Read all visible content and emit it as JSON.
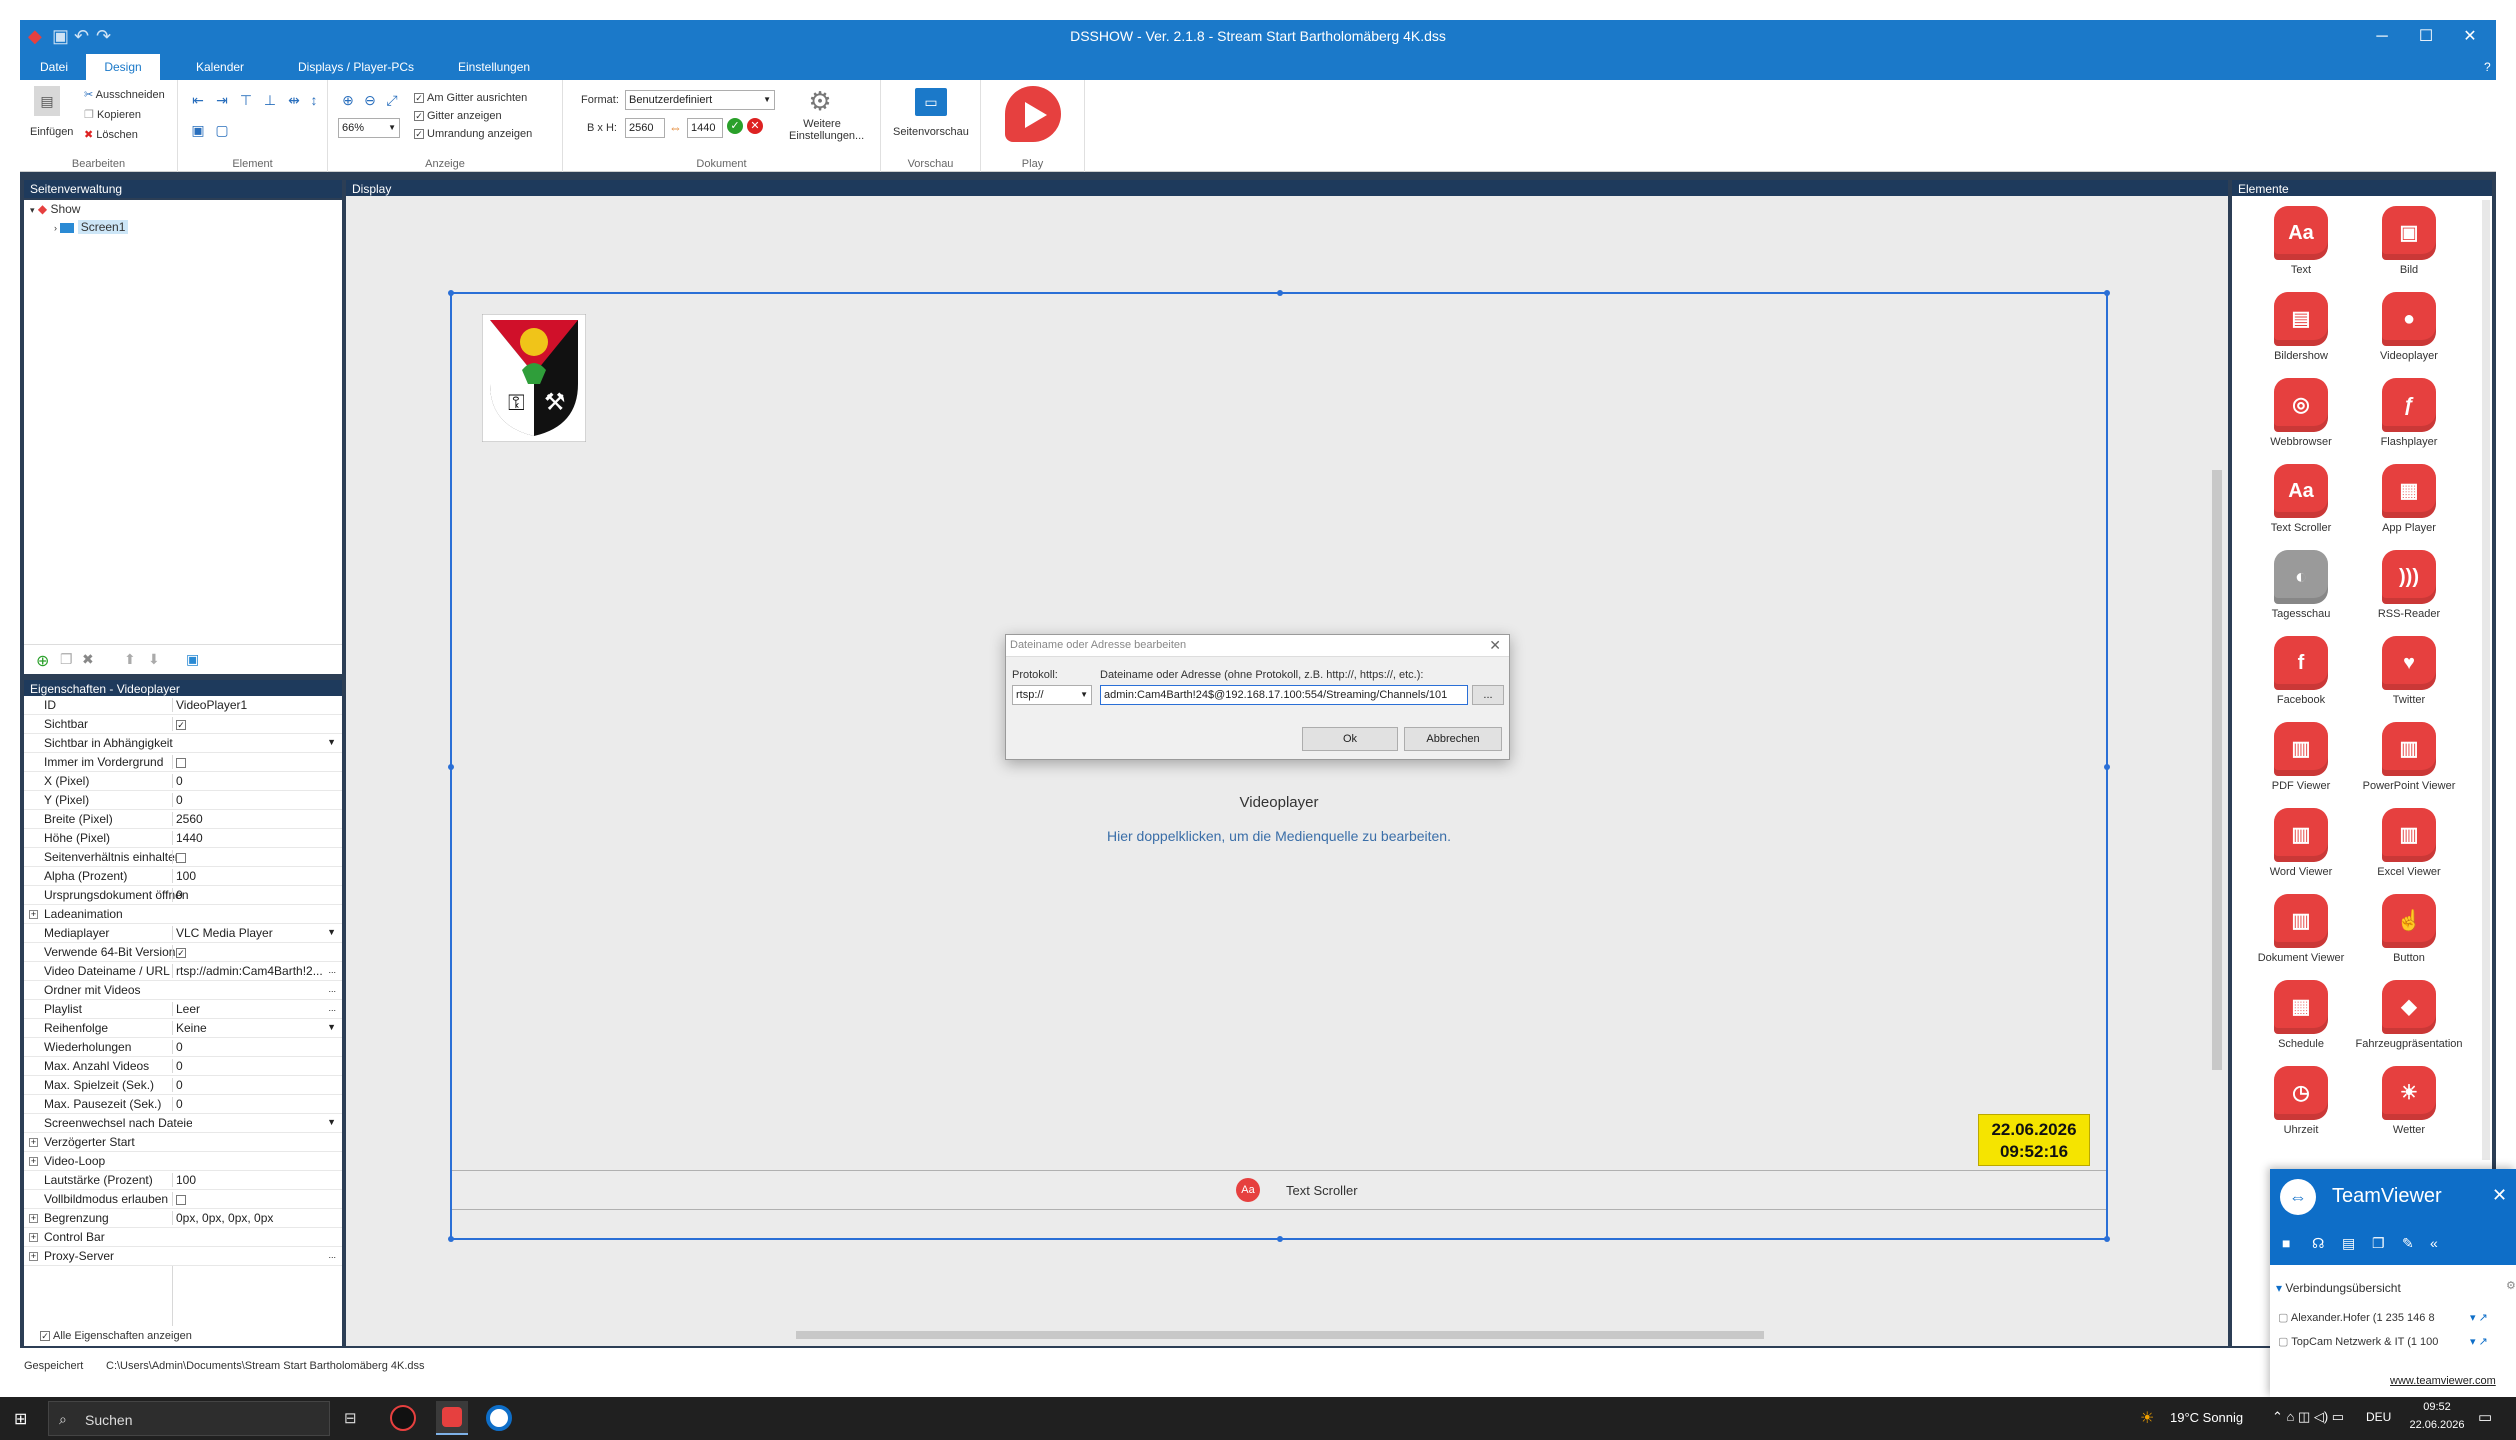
{
  "app": {
    "title": "DSSHOW - Ver. 2.1.8 - Stream Start Bartholomäberg 4K.dss",
    "menu_tabs": [
      "Datei",
      "Design",
      "Kalender",
      "Displays / Player-PCs",
      "Einstellungen"
    ],
    "active_tab": "Design"
  },
  "ribbon": {
    "bearbeiten": {
      "label": "Bearbeiten",
      "paste": "Einfügen",
      "cut": "Ausschneiden",
      "copy": "Kopieren",
      "delete": "Löschen"
    },
    "element": {
      "label": "Element"
    },
    "anzeige": {
      "label": "Anzeige",
      "zoom": "66%",
      "grid_snap": "Am Gitter ausrichten",
      "grid_show": "Gitter anzeigen",
      "border_show": "Umrandung anzeigen"
    },
    "dokument": {
      "label": "Dokument",
      "format_label": "Format:",
      "format_value": "Benutzerdefiniert",
      "size_label": "B x H:",
      "width": "2560",
      "height": "1440",
      "more_settings": "Weitere Einstellungen..."
    },
    "vorschau": {
      "label": "Vorschau",
      "page_preview": "Seitenvorschau"
    },
    "play": {
      "label": "Play"
    }
  },
  "left": {
    "pages_title": "Seitenverwaltung",
    "tree": {
      "root": "Show",
      "child": "Screen1"
    },
    "props_title": "Eigenschaften - Videoplayer",
    "props": [
      {
        "name": "ID",
        "value": "VideoPlayer1"
      },
      {
        "name": "Sichtbar",
        "value": "",
        "check": "true"
      },
      {
        "name": "Sichtbar in Abhängigkeit",
        "value": "",
        "dd": "true"
      },
      {
        "name": "Immer im Vordergrund",
        "value": "",
        "check": "false"
      },
      {
        "name": "X (Pixel)",
        "value": "0"
      },
      {
        "name": "Y (Pixel)",
        "value": "0"
      },
      {
        "name": "Breite (Pixel)",
        "value": "2560"
      },
      {
        "name": "Höhe (Pixel)",
        "value": "1440"
      },
      {
        "name": "Seitenverhältnis einhalten",
        "value": "",
        "check": "false"
      },
      {
        "name": "Alpha (Prozent)",
        "value": "100"
      },
      {
        "name": "Ursprungsdokument öffnen",
        "value": "0"
      },
      {
        "name": "Ladeanimation",
        "value": "",
        "exp": "true"
      },
      {
        "name": "Mediaplayer",
        "value": "VLC Media Player",
        "dd": "true"
      },
      {
        "name": "Verwende 64-Bit Version",
        "value": "",
        "check": "true"
      },
      {
        "name": "Video Dateiname / URL",
        "value": "rtsp://admin:Cam4Barth!2...",
        "more": "true"
      },
      {
        "name": "Ordner mit Videos",
        "value": "",
        "more": "true"
      },
      {
        "name": "Playlist",
        "value": "Leer",
        "more": "true"
      },
      {
        "name": "Reihenfolge",
        "value": "Keine",
        "dd": "true"
      },
      {
        "name": "Wiederholungen",
        "value": "0"
      },
      {
        "name": "Max. Anzahl Videos",
        "value": "0"
      },
      {
        "name": "Max. Spielzeit (Sek.)",
        "value": "0"
      },
      {
        "name": "Max. Pausezeit (Sek.)",
        "value": "0"
      },
      {
        "name": "Screenwechsel nach Dateiende",
        "value": "",
        "dd": "true"
      },
      {
        "name": "Verzögerter Start",
        "value": "",
        "exp": "true"
      },
      {
        "name": "Video-Loop",
        "value": "",
        "exp": "true"
      },
      {
        "name": "Lautstärke (Prozent)",
        "value": "100"
      },
      {
        "name": "Vollbildmodus erlauben",
        "value": "",
        "check": "false"
      },
      {
        "name": "Begrenzung",
        "value": "0px, 0px, 0px, 0px",
        "exp": "true"
      },
      {
        "name": "Control Bar",
        "value": "",
        "exp": "true"
      },
      {
        "name": "Proxy-Server",
        "value": "",
        "exp": "true",
        "more": "true"
      }
    ],
    "show_all": "Alle Eigenschaften anzeigen"
  },
  "display": {
    "title": "Display",
    "videoplayer_label": "Videoplayer",
    "videoplayer_hint": "Hier doppelklicken, um die Medienquelle zu bearbeiten.",
    "clock_date": "22.06.2026",
    "clock_time": "09:52:16",
    "scroller_label": "Text Scroller"
  },
  "dialog": {
    "title": "Dateiname oder Adresse bearbeiten",
    "protocol_label": "Protokoll:",
    "protocol_value": "rtsp://",
    "address_label": "Dateiname oder Adresse (ohne Protokoll, z.B. http://, https://, etc.):",
    "address_value": "admin:Cam4Barth!24$@192.168.17.100:554/Streaming/Channels/101",
    "browse": "...",
    "ok": "Ok",
    "cancel": "Abbrechen"
  },
  "elements": {
    "title": "Elemente",
    "items": [
      {
        "label": "Text",
        "icon": "Aa"
      },
      {
        "label": "Bild",
        "icon": "▣"
      },
      {
        "label": "Bildershow",
        "icon": "▤"
      },
      {
        "label": "Videoplayer",
        "icon": "●"
      },
      {
        "label": "Webbrowser",
        "icon": "◎"
      },
      {
        "label": "Flashplayer",
        "icon": "ƒ"
      },
      {
        "label": "Text Scroller",
        "icon": "Aa"
      },
      {
        "label": "App Player",
        "icon": "▦"
      },
      {
        "label": "Tagesschau",
        "icon": "◐"
      },
      {
        "label": "RSS-Reader",
        "icon": ")))"
      },
      {
        "label": "Facebook",
        "icon": "f"
      },
      {
        "label": "Twitter",
        "icon": "♥"
      },
      {
        "label": "PDF Viewer",
        "icon": "▥"
      },
      {
        "label": "PowerPoint Viewer",
        "icon": "▥"
      },
      {
        "label": "Word Viewer",
        "icon": "▥"
      },
      {
        "label": "Excel Viewer",
        "icon": "▥"
      },
      {
        "label": "Dokument Viewer",
        "icon": "▥"
      },
      {
        "label": "Button",
        "icon": "☝"
      },
      {
        "label": "Schedule",
        "icon": "▦"
      },
      {
        "label": "Fahrzeugpräsentation",
        "icon": "◆"
      },
      {
        "label": "Uhrzeit",
        "icon": "◷"
      },
      {
        "label": "Wetter",
        "icon": "☀"
      }
    ]
  },
  "status": {
    "state": "Gespeichert",
    "path": "C:\\Users\\Admin\\Documents\\Stream Start Bartholomäberg 4K.dss"
  },
  "teamviewer": {
    "title": "TeamViewer",
    "section": "Verbindungsübersicht",
    "conn1": "Alexander.Hofer (1 235 146 8",
    "conn2": "TopCam Netzwerk & IT (1 100",
    "link": "www.teamviewer.com"
  },
  "taskbar": {
    "search": "Suchen",
    "weather": "19°C Sonnig",
    "lang": "DEU",
    "time": "09:52",
    "date": "22.06.2026"
  },
  "colors": {
    "accent": "#1b79c9",
    "element_red": "#e6403f",
    "clock_yellow": "#f5e400",
    "selection": "#2a6fd6"
  }
}
